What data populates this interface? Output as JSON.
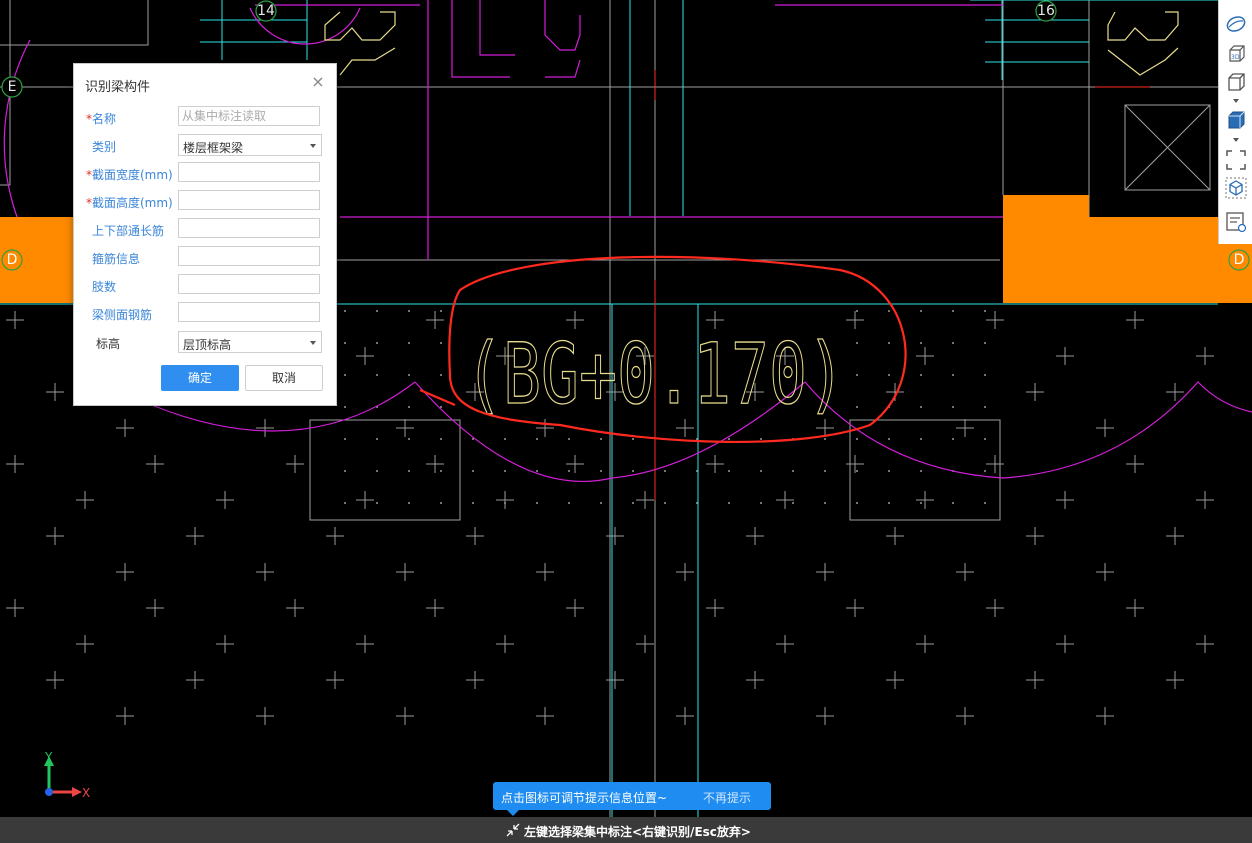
{
  "canvas": {
    "grid_labels": {
      "left_e": "E",
      "left_d": "D",
      "right_d": "D",
      "top_14": "14",
      "top_16": "16"
    },
    "annotation_text": "(BG+0.170)",
    "axis": {
      "x": "X",
      "y": "Y"
    },
    "colors": {
      "background": "#000000",
      "cyan": "#2ee6e6",
      "magenta": "#d21fd8",
      "orange": "#ff8a00",
      "yellow": "#e7dc8c",
      "red": "#ff2a1f",
      "gray": "#a0a0a0"
    }
  },
  "dialog": {
    "title": "识别梁构件",
    "fields": [
      {
        "label": "名称",
        "required": true,
        "value": "",
        "placeholder": "从集中标注读取"
      },
      {
        "label": "类别",
        "required": false,
        "value": "楼层框架梁",
        "type": "select"
      },
      {
        "label": "截面宽度(mm)",
        "required": true,
        "value": ""
      },
      {
        "label": "截面高度(mm)",
        "required": true,
        "value": ""
      },
      {
        "label": "上下部通长筋",
        "required": false,
        "value": ""
      },
      {
        "label": "箍筋信息",
        "required": false,
        "value": ""
      },
      {
        "label": "肢数",
        "required": false,
        "value": ""
      },
      {
        "label": "梁侧面钢筋",
        "required": false,
        "value": ""
      },
      {
        "label": "标高",
        "required": false,
        "value": "层顶标高",
        "type": "select"
      }
    ],
    "ok_label": "确定",
    "cancel_label": "取消",
    "required_mark": "*"
  },
  "toolbar": {
    "items": [
      "sphere-view-icon",
      "3d-view-icon",
      "cube-view-icon",
      "solid-cube-icon",
      "fullscreen-icon",
      "iso-cube-icon",
      "layer-list-icon"
    ],
    "cube_label": "3D"
  },
  "tooltip": {
    "text": "点击图标可调节提示信息位置~",
    "dismiss_label": "不再提示"
  },
  "status": {
    "text": "左键选择梁集中标注<右键识别/Esc放弃>"
  }
}
